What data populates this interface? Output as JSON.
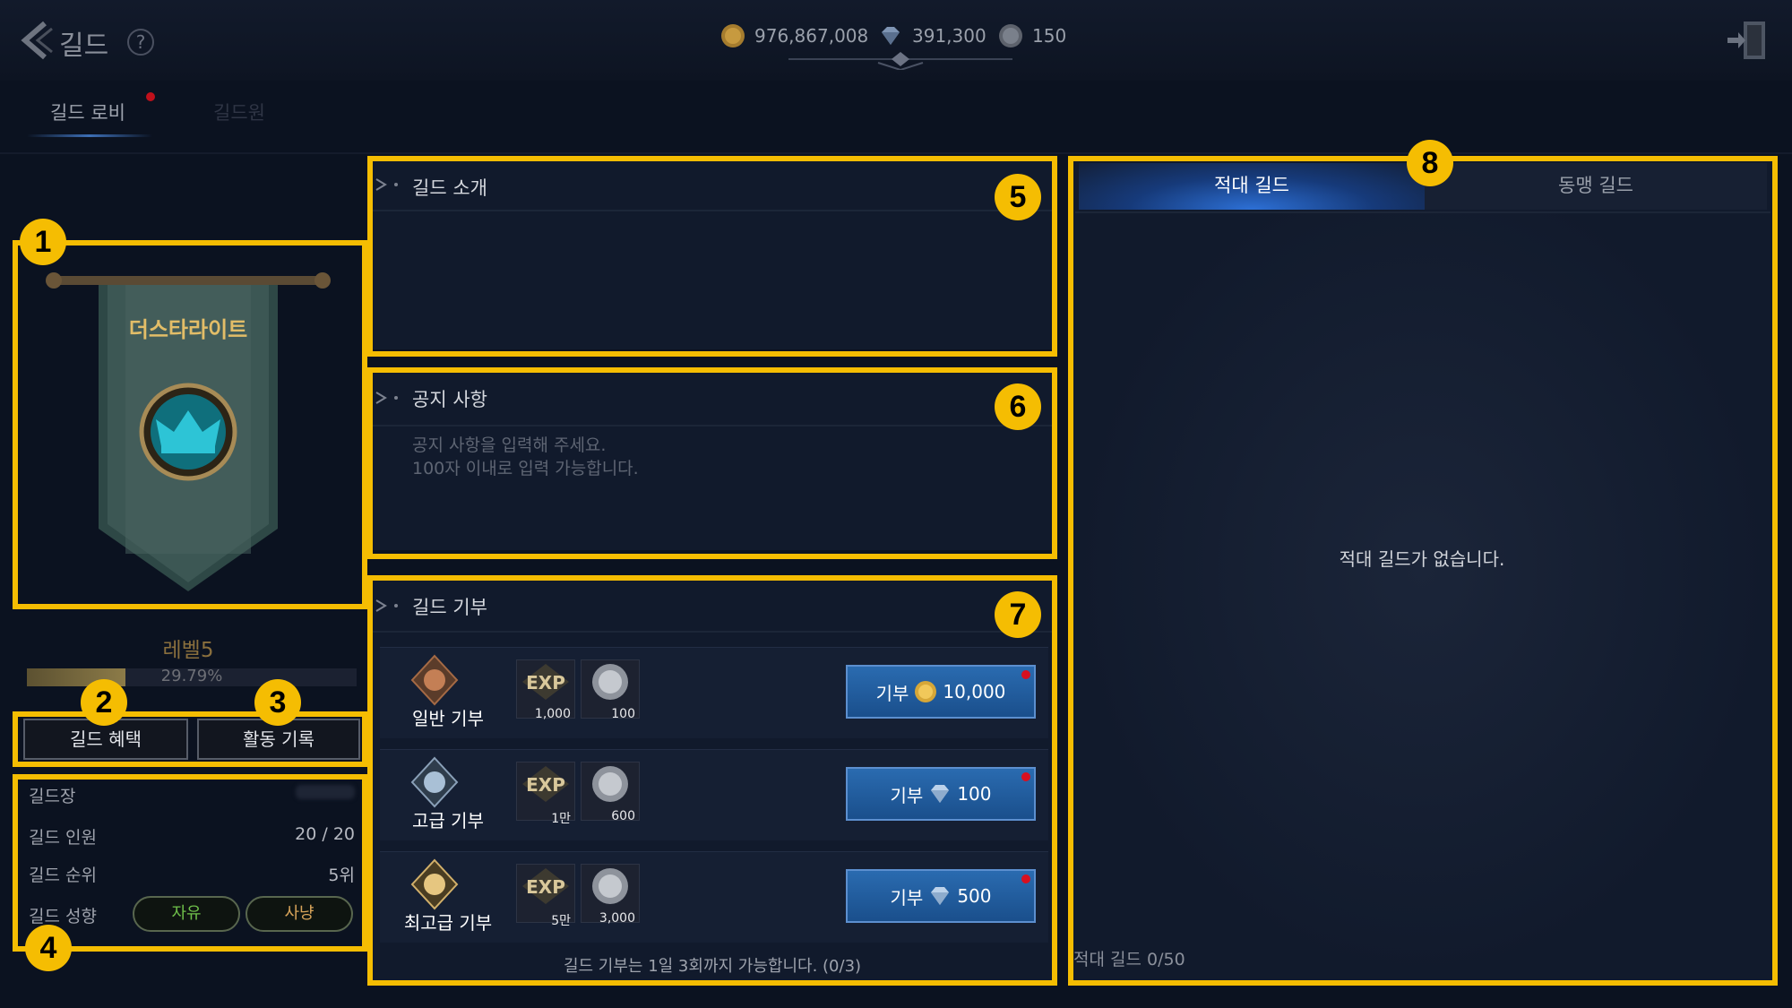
{
  "header": {
    "title": "길드",
    "help": "?",
    "gold": "976,867,008",
    "diamond": "391,300",
    "silver": "150"
  },
  "tabs": [
    {
      "label": "길드 로비",
      "active": true
    },
    {
      "label": "길드원",
      "active": false
    }
  ],
  "badges": [
    "1",
    "2",
    "3",
    "4",
    "5",
    "6",
    "7",
    "8"
  ],
  "left": {
    "guild_name": "더스타라이트",
    "level": "레벨5",
    "xp_percent_text": "29.79%",
    "xp_fraction": 0.2979,
    "benefit_button": "길드 혜택",
    "activity_button": "활동 기록",
    "info": {
      "leader_label": "길드장",
      "members_label": "길드 인원",
      "members_value": "20 / 20",
      "rank_label": "길드 순위",
      "rank_value": "5위",
      "tendency_label": "길드 성향",
      "tendencies": [
        "자유",
        "사냥"
      ]
    }
  },
  "intro": {
    "title": "길드 소개"
  },
  "notice": {
    "title": "공지 사항",
    "placeholder_line1": "공지 사항을 입력해 주세요.",
    "placeholder_line2": "100자 이내로 입력 가능합니다."
  },
  "donation": {
    "title": "길드 기부",
    "rows": [
      {
        "label": "일반 기부",
        "exp": "1,000",
        "silver": "100",
        "button": "기부",
        "cost": "10,000",
        "currency": "gold"
      },
      {
        "label": "고급 기부",
        "exp": "1만",
        "silver": "600",
        "button": "기부",
        "cost": "100",
        "currency": "diamond"
      },
      {
        "label": "최고급 기부",
        "exp": "5만",
        "silver": "3,000",
        "button": "기부",
        "cost": "500",
        "currency": "diamond"
      }
    ],
    "exp_text": "EXP",
    "note": "길드 기부는 1일 3회까지 가능합니다. (0/3)"
  },
  "relations": {
    "tab_hostile": "적대 길드",
    "tab_alliance": "동맹 길드",
    "empty": "적대 길드가 없습니다.",
    "count": "적대 길드 0/50"
  },
  "colors": {
    "highlight": "#f5bd02",
    "background": "#0b1220",
    "button_blue": "#2a6bb0",
    "gold_text": "#e2bd68",
    "notification": "#d81020"
  }
}
